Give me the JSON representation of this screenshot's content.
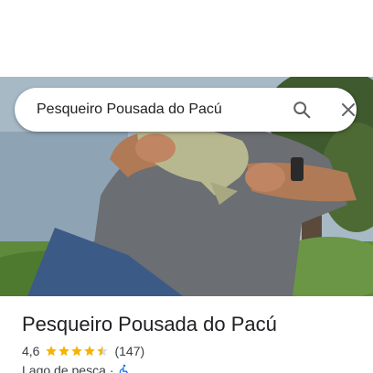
{
  "search": {
    "query": "Pesqueiro Pousada do Pacú"
  },
  "icons": {
    "search": "search-icon",
    "close": "close-icon",
    "accessibility": "wheelchair-accessible-icon",
    "star": "star-icon"
  },
  "place": {
    "title": "Pesqueiro Pousada do Pacú",
    "rating": "4,6",
    "stars_filled": 4.5,
    "stars_total": 5,
    "review_count": "(147)",
    "category": "Lago de pesca",
    "separator": "·"
  },
  "colors": {
    "star": "#f5b400",
    "accessibility": "#1a73e8",
    "icon_gray": "#5f6368"
  }
}
